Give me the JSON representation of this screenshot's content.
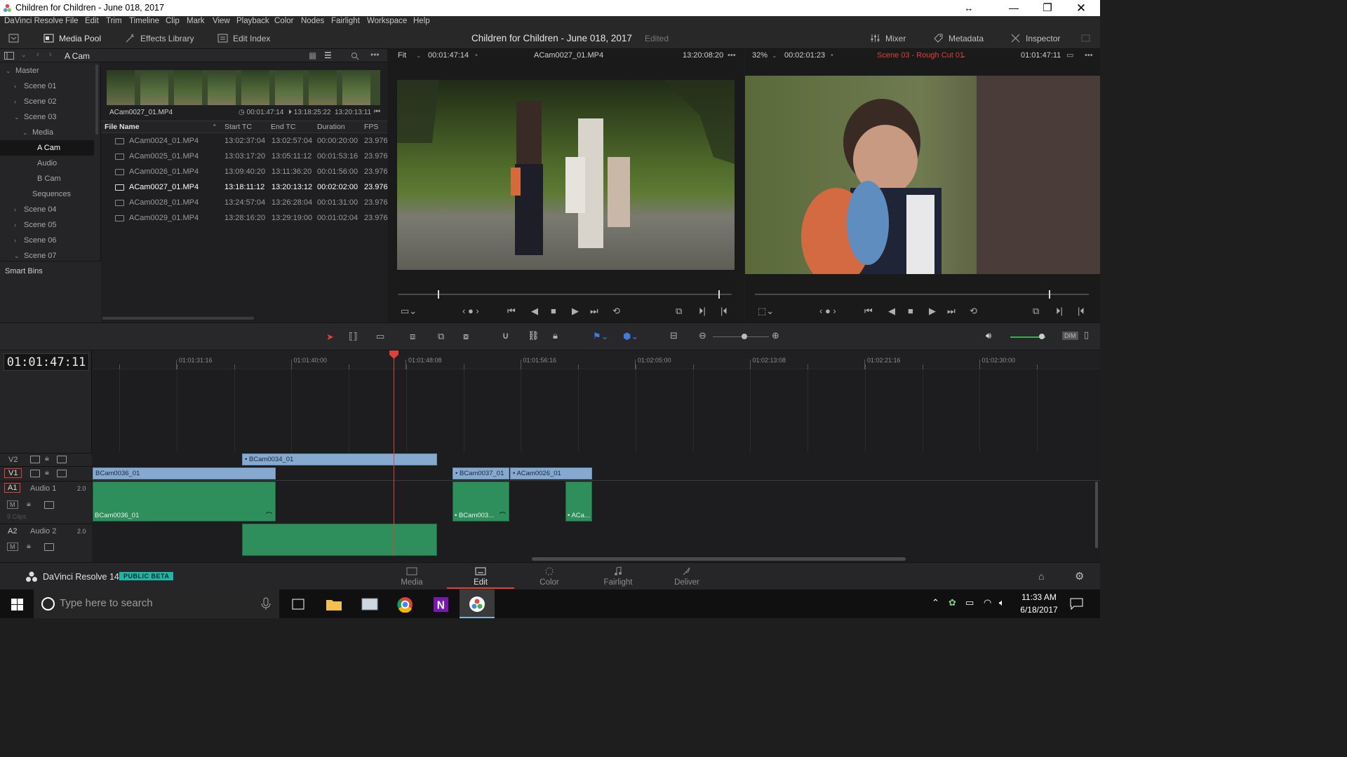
{
  "window": {
    "title": "Children for Children - June 018, 2017"
  },
  "menu": [
    "DaVinci Resolve",
    "File",
    "Edit",
    "Trim",
    "Timeline",
    "Clip",
    "Mark",
    "View",
    "Playback",
    "Color",
    "Nodes",
    "Fairlight",
    "Workspace",
    "Help"
  ],
  "toolbar": {
    "media_pool": "Media Pool",
    "effects_library": "Effects Library",
    "edit_index": "Edit Index",
    "project_title": "Children for Children - June 018, 2017",
    "edited": "Edited",
    "mixer": "Mixer",
    "metadata": "Metadata",
    "inspector": "Inspector"
  },
  "bin": {
    "current": "A Cam"
  },
  "tree": [
    {
      "label": "Master",
      "level": 0,
      "chevron": "down"
    },
    {
      "label": "Scene 01",
      "level": 1,
      "chevron": "right"
    },
    {
      "label": "Scene 02",
      "level": 1,
      "chevron": "right"
    },
    {
      "label": "Scene 03",
      "level": 1,
      "chevron": "down"
    },
    {
      "label": "Media",
      "level": 2,
      "chevron": "down"
    },
    {
      "label": "A Cam",
      "level": 3,
      "chevron": "",
      "selected": true
    },
    {
      "label": "Audio",
      "level": 3,
      "chevron": ""
    },
    {
      "label": "B Cam",
      "level": 3,
      "chevron": ""
    },
    {
      "label": "Sequences",
      "level": 2,
      "chevron": ""
    },
    {
      "label": "Scene 04",
      "level": 1,
      "chevron": "right"
    },
    {
      "label": "Scene 05",
      "level": 1,
      "chevron": "right"
    },
    {
      "label": "Scene 06",
      "level": 1,
      "chevron": "right"
    },
    {
      "label": "Scene 07",
      "level": 1,
      "chevron": "down"
    }
  ],
  "smart_bins": "Smart Bins",
  "filmstrip": {
    "name": "ACam0027_01.MP4",
    "duration": "00:01:47:14",
    "in": "13:18:25:22",
    "out": "13:20:13:11"
  },
  "file_columns": [
    "File Name",
    "Start TC",
    "End TC",
    "Duration",
    "FPS"
  ],
  "files": [
    [
      "ACam0024_01.MP4",
      "13:02:37:04",
      "13:02:57:04",
      "00:00:20:00",
      "23.976"
    ],
    [
      "ACam0025_01.MP4",
      "13:03:17:20",
      "13:05:11:12",
      "00:01:53:16",
      "23.976"
    ],
    [
      "ACam0026_01.MP4",
      "13:09:40:20",
      "13:11:36:20",
      "00:01:56:00",
      "23.976"
    ],
    [
      "ACam0027_01.MP4",
      "13:18:11:12",
      "13:20:13:12",
      "00:02:02:00",
      "23.976"
    ],
    [
      "ACam0028_01.MP4",
      "13:24:57:04",
      "13:26:28:04",
      "00:01:31:00",
      "23.976"
    ],
    [
      "ACam0029_01.MP4",
      "13:28:16:20",
      "13:29:19:00",
      "00:01:02:04",
      "23.976"
    ]
  ],
  "selected_file_index": 3,
  "source_viewer": {
    "zoom": "Fit",
    "duration": "00:01:47:14",
    "clip": "ACam0027_01.MP4",
    "timecode": "13:20:08:20",
    "playhead_fraction": 0.12
  },
  "record_viewer": {
    "zoom": "32%",
    "duration": "00:02:01:23",
    "timeline": "Scene 03 - Rough Cut 01",
    "timecode": "01:01:47:11",
    "playhead_fraction": 0.88
  },
  "timecode": "01:01:47:11",
  "ruler": [
    "01:01:31:16",
    "01:01:40:00",
    "01:01:48:08",
    "01:01:56:16",
    "01:02:05:00",
    "01:02:13:08",
    "01:02:21:16",
    "01:02:30:00"
  ],
  "tracks": {
    "v2": "V2",
    "v1": "V1",
    "a1": "A1",
    "a1_name": "Audio 1",
    "a1_ch": "2.0",
    "a1_clips": "9 Clips",
    "a2": "A2",
    "a2_name": "Audio 2",
    "a2_ch": "2.0",
    "m": "M"
  },
  "clips": {
    "v2_1": "BCam0034_01",
    "v1_1": "BCam0036_01",
    "v1_2": "BCam0037_01",
    "v1_3": "ACam0026_01",
    "a1_1": "BCam0036_01",
    "a1_2": "BCam003...",
    "a1_3": "ACa..."
  },
  "brand": {
    "name": "DaVinci Resolve 14",
    "badge": "PUBLIC BETA"
  },
  "pages": [
    "Media",
    "Edit",
    "Color",
    "Fairlight",
    "Deliver"
  ],
  "active_page": "Edit",
  "taskbar": {
    "search_placeholder": "Type here to search",
    "time": "11:33 AM",
    "date": "6/18/2017"
  },
  "colors": {
    "accent_red": "#e0403a",
    "video_clip": "#86a9cf",
    "audio_clip": "#2f8f5c",
    "badge": "#1fb5a8"
  }
}
